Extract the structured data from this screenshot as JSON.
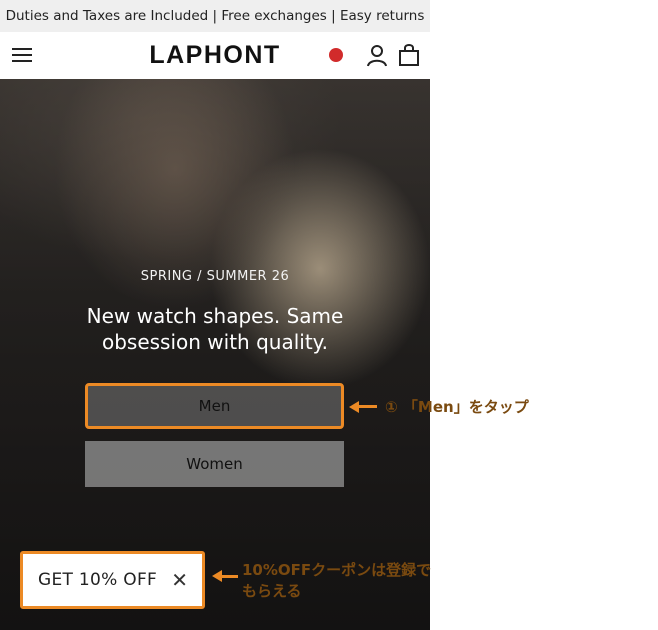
{
  "promo_bar": {
    "text": "Duties and Taxes are Included | Free exchanges | Easy returns"
  },
  "header": {
    "brand": "LAPHONT",
    "menu_icon": "hamburger-menu-icon",
    "flag_icon": "region-flag-icon",
    "account_icon": "user-account-icon",
    "bag_icon": "shopping-bag-icon",
    "flag_color": "#d12b2b"
  },
  "hero": {
    "kicker": "SPRING / SUMMER 26",
    "headline": "New watch shapes. Same obsession with quality.",
    "buttons": [
      {
        "label": "Men"
      },
      {
        "label": "Women"
      }
    ]
  },
  "coupon": {
    "label": "GET 10% OFF",
    "close": "✕"
  },
  "annotations": {
    "men_tip": "① 「Men」をタップ",
    "coupon_tip": "10%OFFクーポンは登録でもらえる"
  },
  "colors": {
    "accent": "#ec8a25",
    "annotation_text": "#7a4a10"
  }
}
